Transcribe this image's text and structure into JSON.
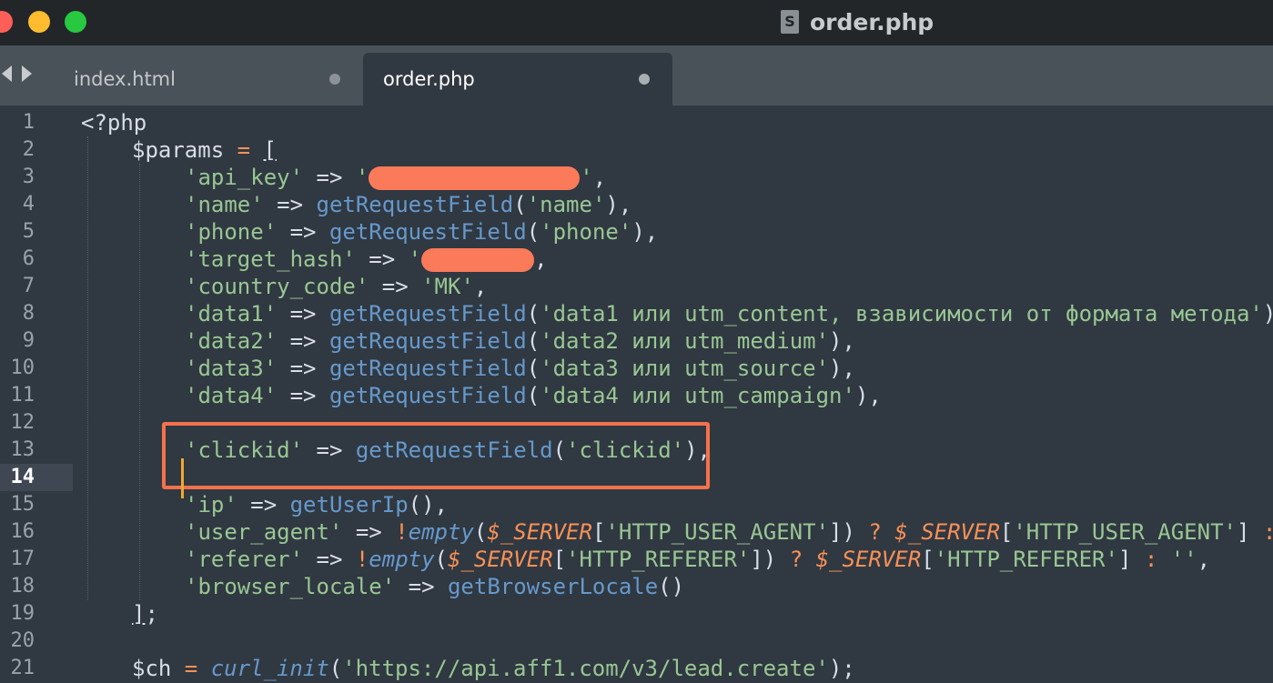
{
  "window": {
    "title": "order.php",
    "file_icon_glyph": "S"
  },
  "colors": {
    "close": "#ff5f57",
    "minimize": "#febc2e",
    "zoom": "#28c840",
    "highlight_box": "#f4714d",
    "redaction": "#fb7a5a"
  },
  "tabs": [
    {
      "label": "index.html",
      "active": false
    },
    {
      "label": "order.php",
      "active": true
    }
  ],
  "editor": {
    "current_line": 14,
    "line_numbers": [
      "1",
      "2",
      "3",
      "4",
      "5",
      "6",
      "7",
      "8",
      "9",
      "10",
      "11",
      "12",
      "13",
      "14",
      "15",
      "16",
      "17",
      "18",
      "19",
      "20",
      "21"
    ],
    "code": {
      "l1_open": "<?php",
      "l2_var": "$params",
      "l2_eq": " = ",
      "l2_br": "[",
      "l3_key": "'api_key'",
      "l3_arrow": " => ",
      "l3_q1": "'",
      "l3_q2": "'",
      "l3_comma": ",",
      "l4_key": "'name'",
      "l4_arrow": " => ",
      "l4_fn": "getRequestField",
      "l4_arg": "'name'",
      "l5_key": "'phone'",
      "l5_arrow": " => ",
      "l5_fn": "getRequestField",
      "l5_arg": "'phone'",
      "l6_key": "'target_hash'",
      "l6_arrow": " => ",
      "l6_q1": "'",
      "l6_comma": ",",
      "l7_key": "'country_code'",
      "l7_arrow": " => ",
      "l7_val": "'MK'",
      "l8_key": "'data1'",
      "l8_arrow": " => ",
      "l8_fn": "getRequestField",
      "l8_arg": "'data1 или utm_content, взависимости от формата метода'",
      "l9_key": "'data2'",
      "l9_arrow": " => ",
      "l9_fn": "getRequestField",
      "l9_arg": "'data2 или utm_medium'",
      "l10_key": "'data3'",
      "l10_arrow": " => ",
      "l10_fn": "getRequestField",
      "l10_arg": "'data3 или utm_source'",
      "l11_key": "'data4'",
      "l11_arrow": " => ",
      "l11_fn": "getRequestField",
      "l11_arg": "'data4 или utm_campaign'",
      "l13_key": "'clickid'",
      "l13_arrow": " => ",
      "l13_fn": "getRequestField",
      "l13_arg": "'clickid'",
      "l15_key": "'ip'",
      "l15_arrow": " => ",
      "l15_fn": "getUserIp",
      "l16_key": "'user_agent'",
      "l16_arrow": " => ",
      "l16_not": "!",
      "l16_fn": "empty",
      "l16_sv": "$_SERVER",
      "l16_idx": "'HTTP_USER_AGENT'",
      "l16_q": " ? ",
      "l16_sv2": "$_SERVER",
      "l16_idx2": "'HTTP_USER_AGENT'",
      "l16_c": " : ",
      "l16_empty": "''",
      "l17_key": "'referer'",
      "l17_arrow": " => ",
      "l17_not": "!",
      "l17_fn": "empty",
      "l17_sv": "$_SERVER",
      "l17_idx": "'HTTP_REFERER'",
      "l17_q": " ? ",
      "l17_sv2": "$_SERVER",
      "l17_idx2": "'HTTP_REFERER'",
      "l17_c": " : ",
      "l17_empty": "''",
      "l18_key": "'browser_locale'",
      "l18_arrow": " => ",
      "l18_fn": "getBrowserLocale",
      "l19_close": "]",
      "l21_var": "$ch",
      "l21_eq": " = ",
      "l21_fn": "curl_init",
      "l21_arg": "'https://api.aff1.com/v3/lead.create'"
    }
  }
}
